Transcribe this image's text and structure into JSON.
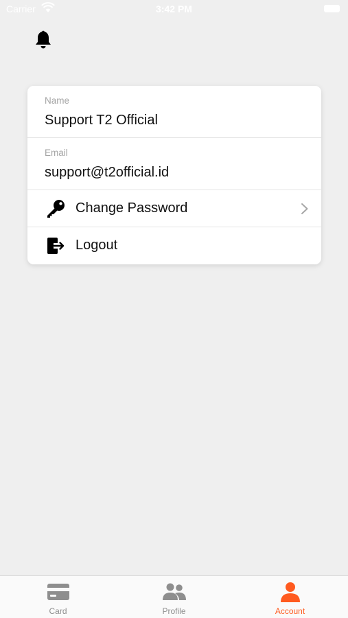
{
  "status_bar": {
    "carrier": "Carrier",
    "time": "3:42 PM"
  },
  "header": {
    "icon": "bell-icon"
  },
  "account": {
    "name_label": "Name",
    "name_value": "Support T2 Official",
    "email_label": "Email",
    "email_value": "support@t2official.id",
    "actions": [
      {
        "label": "Change Password",
        "icon": "key-icon"
      },
      {
        "label": "Logout",
        "icon": "logout-icon"
      }
    ]
  },
  "tab_bar": {
    "accent_color": "#ff5a1f",
    "inactive_color": "#8e8e8e",
    "tabs": [
      {
        "label": "Card",
        "icon": "card-icon",
        "active": false
      },
      {
        "label": "Profile",
        "icon": "users-icon",
        "active": false
      },
      {
        "label": "Account",
        "icon": "user-icon",
        "active": true
      }
    ]
  }
}
